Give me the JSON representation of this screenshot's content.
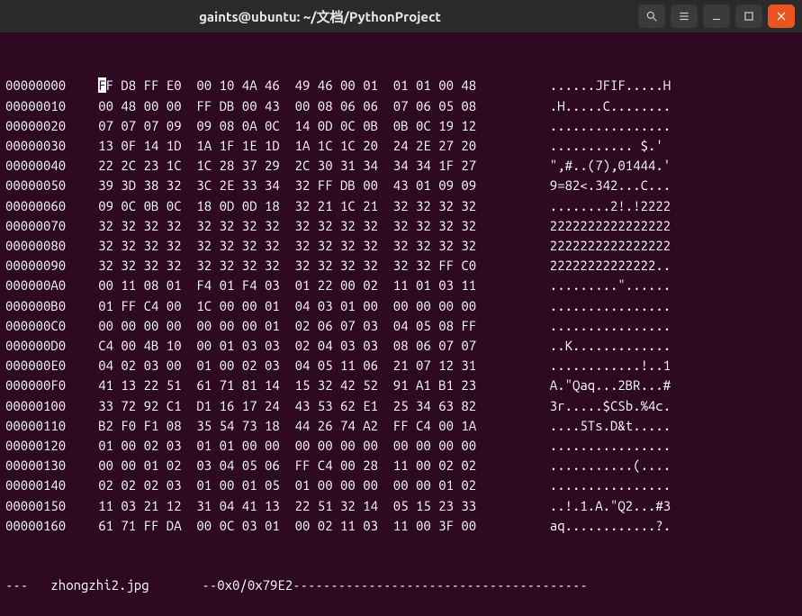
{
  "titlebar": {
    "title": "gaints@ubuntu: ~/文档/PythonProject"
  },
  "status": {
    "filename": "zhongzhi2.jpg",
    "position": "--0x0/0x79E2",
    "leading_dashes": "---   ",
    "gap": "       ",
    "trailing_dashes": "---------------------------------------"
  },
  "rows": [
    {
      "offset": "00000000",
      "hex": "FF D8 FF E0  00 10 4A 46  49 46 00 01  01 01 00 48",
      "ascii": "......JFIF.....H"
    },
    {
      "offset": "00000010",
      "hex": "00 48 00 00  FF DB 00 43  00 08 06 06  07 06 05 08",
      "ascii": ".H.....C........"
    },
    {
      "offset": "00000020",
      "hex": "07 07 07 09  09 08 0A 0C  14 0D 0C 0B  0B 0C 19 12",
      "ascii": "................"
    },
    {
      "offset": "00000030",
      "hex": "13 0F 14 1D  1A 1F 1E 1D  1A 1C 1C 20  24 2E 27 20",
      "ascii": "........... $.' "
    },
    {
      "offset": "00000040",
      "hex": "22 2C 23 1C  1C 28 37 29  2C 30 31 34  34 34 1F 27",
      "ascii": "\",#..(7),01444.'"
    },
    {
      "offset": "00000050",
      "hex": "39 3D 38 32  3C 2E 33 34  32 FF DB 00  43 01 09 09",
      "ascii": "9=82<.342...C..."
    },
    {
      "offset": "00000060",
      "hex": "09 0C 0B 0C  18 0D 0D 18  32 21 1C 21  32 32 32 32",
      "ascii": "........2!.!2222"
    },
    {
      "offset": "00000070",
      "hex": "32 32 32 32  32 32 32 32  32 32 32 32  32 32 32 32",
      "ascii": "2222222222222222"
    },
    {
      "offset": "00000080",
      "hex": "32 32 32 32  32 32 32 32  32 32 32 32  32 32 32 32",
      "ascii": "2222222222222222"
    },
    {
      "offset": "00000090",
      "hex": "32 32 32 32  32 32 32 32  32 32 32 32  32 32 FF C0",
      "ascii": "22222222222222.."
    },
    {
      "offset": "000000A0",
      "hex": "00 11 08 01  F4 01 F4 03  01 22 00 02  11 01 03 11",
      "ascii": ".........\"......"
    },
    {
      "offset": "000000B0",
      "hex": "01 FF C4 00  1C 00 00 01  04 03 01 00  00 00 00 00",
      "ascii": "................"
    },
    {
      "offset": "000000C0",
      "hex": "00 00 00 00  00 00 00 01  02 06 07 03  04 05 08 FF",
      "ascii": "................"
    },
    {
      "offset": "000000D0",
      "hex": "C4 00 4B 10  00 01 03 03  02 04 03 03  08 06 07 07",
      "ascii": "..K............."
    },
    {
      "offset": "000000E0",
      "hex": "04 02 03 00  01 00 02 03  04 05 11 06  21 07 12 31",
      "ascii": "............!..1"
    },
    {
      "offset": "000000F0",
      "hex": "41 13 22 51  61 71 81 14  15 32 42 52  91 A1 B1 23",
      "ascii": "A.\"Qaq...2BR...#"
    },
    {
      "offset": "00000100",
      "hex": "33 72 92 C1  D1 16 17 24  43 53 62 E1  25 34 63 82",
      "ascii": "3r.....$CSb.%4c."
    },
    {
      "offset": "00000110",
      "hex": "B2 F0 F1 08  35 54 73 18  44 26 74 A2  FF C4 00 1A",
      "ascii": "....5Ts.D&t....."
    },
    {
      "offset": "00000120",
      "hex": "01 00 02 03  01 01 00 00  00 00 00 00  00 00 00 00",
      "ascii": "................"
    },
    {
      "offset": "00000130",
      "hex": "00 00 01 02  03 04 05 06  FF C4 00 28  11 00 02 02",
      "ascii": "...........(...."
    },
    {
      "offset": "00000140",
      "hex": "02 02 02 03  01 00 01 05  01 00 00 00  00 00 01 02",
      "ascii": "................"
    },
    {
      "offset": "00000150",
      "hex": "11 03 21 12  31 04 41 13  22 51 32 14  05 15 23 33",
      "ascii": "..!.1.A.\"Q2...#3"
    },
    {
      "offset": "00000160",
      "hex": "61 71 FF DA  00 0C 03 01  00 02 11 03  11 00 3F 00",
      "ascii": "aq............?."
    }
  ]
}
